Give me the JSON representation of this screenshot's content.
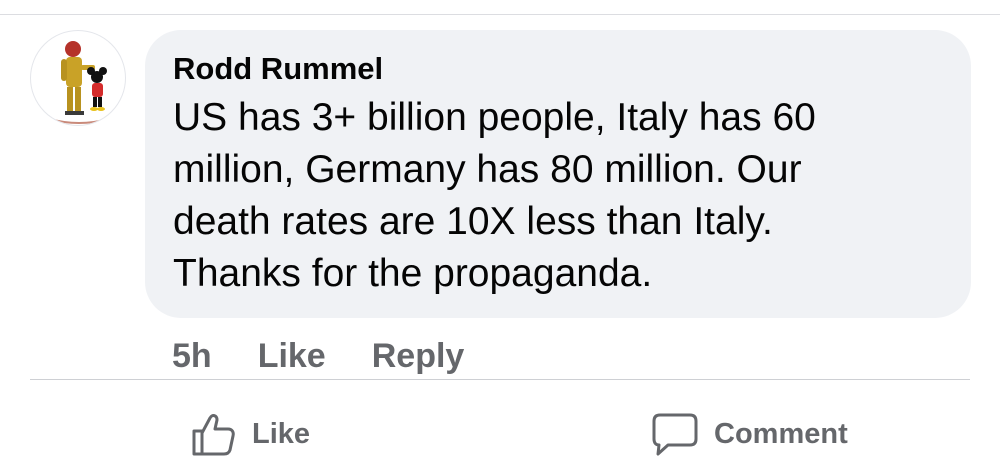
{
  "comment": {
    "author": "Rodd Rummel",
    "text": "US has 3+ billion people, Italy has 60 million, Germany has 80 million.  Our death rates are 10X less than Italy. Thanks for the propaganda.",
    "time": "5h",
    "like_label": "Like",
    "reply_label": "Reply"
  },
  "footer": {
    "like_label": "Like",
    "comment_label": "Comment"
  },
  "icons": {
    "like": "thumbs-up-icon",
    "comment": "speech-bubble-icon"
  },
  "colors": {
    "bubble_bg": "#f0f2f5",
    "text": "#050505",
    "secondary_text": "#65676b",
    "divider": "#ced0d4"
  }
}
